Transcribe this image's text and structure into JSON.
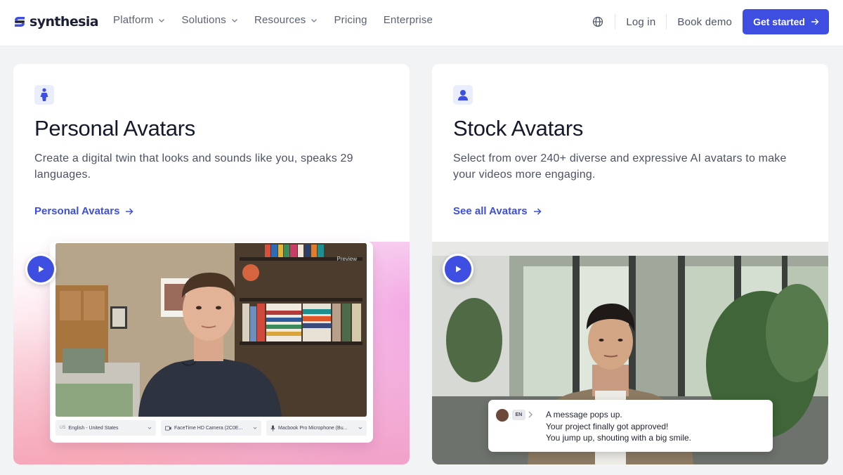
{
  "brand": {
    "name": "synthesia",
    "accent": "#3d4ee0"
  },
  "nav": {
    "menu": [
      {
        "label": "Platform",
        "has_dropdown": true
      },
      {
        "label": "Solutions",
        "has_dropdown": true
      },
      {
        "label": "Resources",
        "has_dropdown": true
      },
      {
        "label": "Pricing",
        "has_dropdown": false
      },
      {
        "label": "Enterprise",
        "has_dropdown": false
      }
    ],
    "language_icon": "globe-icon",
    "login_label": "Log in",
    "demo_label": "Book demo",
    "cta_label": "Get started"
  },
  "cards": [
    {
      "icon": "person-standing-icon",
      "title": "Personal Avatars",
      "description": "Create a digital twin that looks and sounds like you, speaks 29 languages.",
      "link_label": "Personal Avatars",
      "media": {
        "preview_label": "Preview",
        "controls": [
          {
            "prefix": "US",
            "label": "English - United States"
          },
          {
            "prefix": "",
            "label": "FaceTime HD Camera (2C0E..."
          },
          {
            "prefix": "",
            "label": "Macbook Pro Microphone (Bu..."
          }
        ]
      }
    },
    {
      "icon": "user-icon",
      "title": "Stock Avatars",
      "description": "Select from over 240+ diverse and expressive AI avatars to make your videos more engaging.",
      "link_label": "See all Avatars",
      "media": {
        "chat_lang": "EN",
        "chat_lines": [
          "A message pops up.",
          "Your project finally got approved!",
          "You jump up, shouting with a big smile."
        ]
      }
    }
  ]
}
